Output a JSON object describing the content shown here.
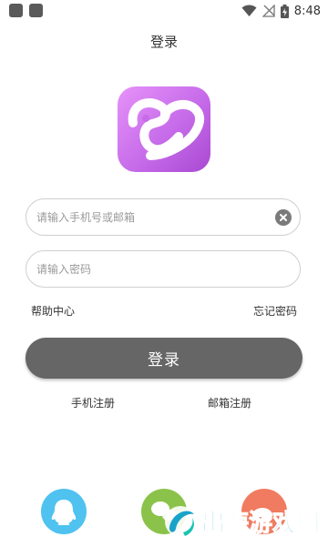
{
  "status_bar": {
    "time": "8:48",
    "icons": [
      "notification-square-icon",
      "notification-square-icon",
      "wifi-icon",
      "signal-off-icon",
      "battery-charging-icon"
    ]
  },
  "header": {
    "title": "登录"
  },
  "logo": {
    "icon": "app-logo-icon"
  },
  "form": {
    "account_placeholder": "请输入手机号或邮箱",
    "account_value": "",
    "password_placeholder": "请输入密码",
    "password_value": "",
    "clear_icon": "clear-icon"
  },
  "links": {
    "help": "帮助中心",
    "forgot": "忘记密码"
  },
  "login_button": {
    "label": "登录"
  },
  "register": {
    "phone": "手机注册",
    "email": "邮箱注册"
  },
  "social_login": [
    {
      "name": "qq",
      "icon": "qq-icon",
      "color": "#4fc2f0"
    },
    {
      "name": "wechat",
      "icon": "wechat-icon",
      "color": "#8bc34a"
    },
    {
      "name": "weibo",
      "icon": "weibo-icon",
      "color": "#f07b60"
    }
  ],
  "watermark": {
    "text": "出海游戏园"
  },
  "colors": {
    "logo_gradient": [
      "#e692fa",
      "#a949d3"
    ],
    "button": "#666666",
    "watermark": "#1aa3c9"
  }
}
